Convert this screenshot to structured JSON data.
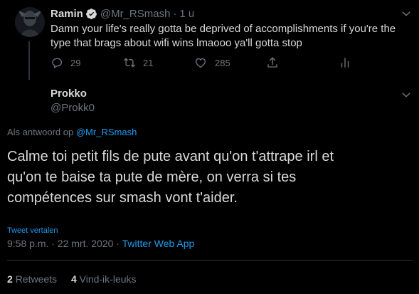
{
  "parent_tweet": {
    "display_name": "Ramin",
    "handle": "@Mr_RSmash",
    "separator": "·",
    "time": "1 u",
    "text_line1": "Damn your life's really gotta be deprived of accomplishments if you're the",
    "text_line2": "type that brags about wifi wins lmaooo ya'll gotta stop",
    "reply_count": "29",
    "retweet_count": "21",
    "like_count": "285"
  },
  "main_tweet": {
    "display_name": "Prokko",
    "handle": "@Prokk0",
    "reply_prefix": "Als antwoord op",
    "reply_to": "@Mr_RSmash",
    "text_line1": "Calme toi petit fils de pute avant qu'on t'attrape irl et",
    "text_line2": "qu'on te baise ta pute de mère, on verra si tes",
    "text_line3": "compétences sur smash vont t'aider.",
    "translate_label": "Tweet vertalen",
    "timestamp": "9:58 p.m. · 22 mrt. 2020",
    "meta_separator": "·",
    "source": "Twitter Web App",
    "retweets_count": "2",
    "retweets_label": "Retweets",
    "likes_count": "4",
    "likes_label": "Vind-ik-leuks"
  },
  "colors": {
    "background": "#000000",
    "text": "#d9d9d9",
    "muted": "#6e767d",
    "accent": "#1d9bf0",
    "divider": "#2f3336",
    "verified": "#d9d9d9"
  },
  "icons": {
    "verified": "verified-badge-icon",
    "reply": "reply-icon",
    "retweet": "retweet-icon",
    "like": "heart-icon",
    "share": "share-icon",
    "analytics": "analytics-icon",
    "caret": "chevron-down-icon"
  }
}
